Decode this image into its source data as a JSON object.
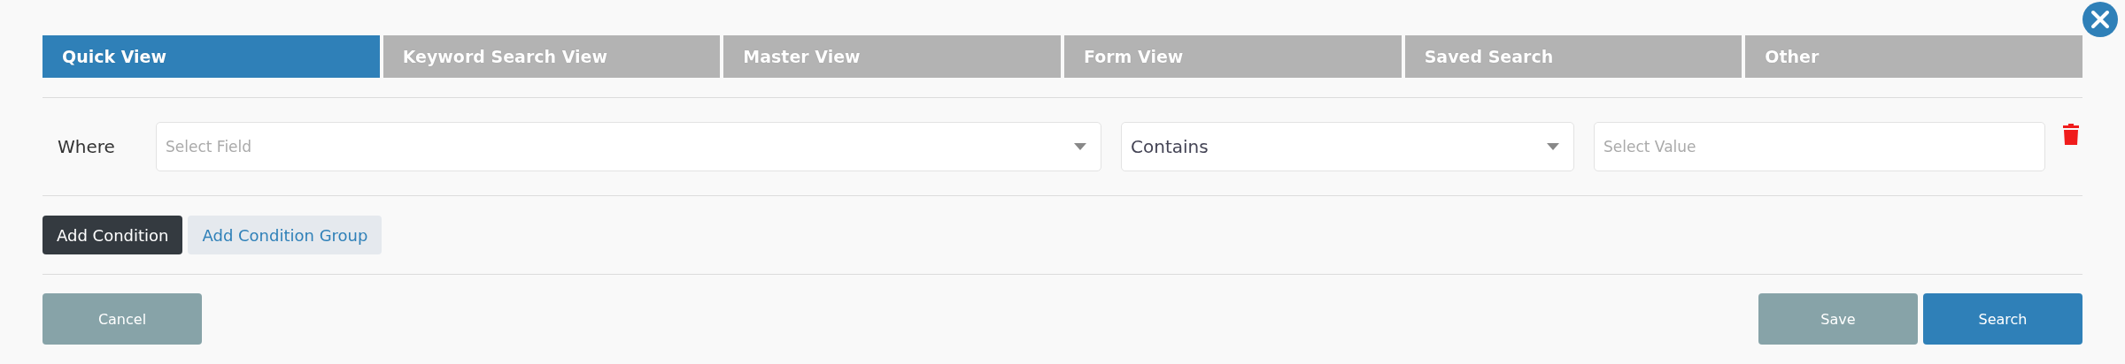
{
  "tabs": [
    {
      "label": "Quick View",
      "selected": true
    },
    {
      "label": "Keyword Search View",
      "selected": false
    },
    {
      "label": "Master View",
      "selected": false
    },
    {
      "label": "Form View",
      "selected": false
    },
    {
      "label": "Saved Search",
      "selected": false
    },
    {
      "label": "Other",
      "selected": false
    }
  ],
  "condition": {
    "label": "Where",
    "field": {
      "placeholder": "Select Field"
    },
    "operator": {
      "value": "Contains"
    },
    "value": {
      "placeholder": "Select Value"
    }
  },
  "condition_buttons": [
    {
      "label": "Add Condition",
      "kind": "dark"
    },
    {
      "label": "Add Condition Group",
      "kind": "light"
    }
  ],
  "footer": {
    "cancel": "Cancel",
    "save": "Save",
    "search": "Search"
  }
}
